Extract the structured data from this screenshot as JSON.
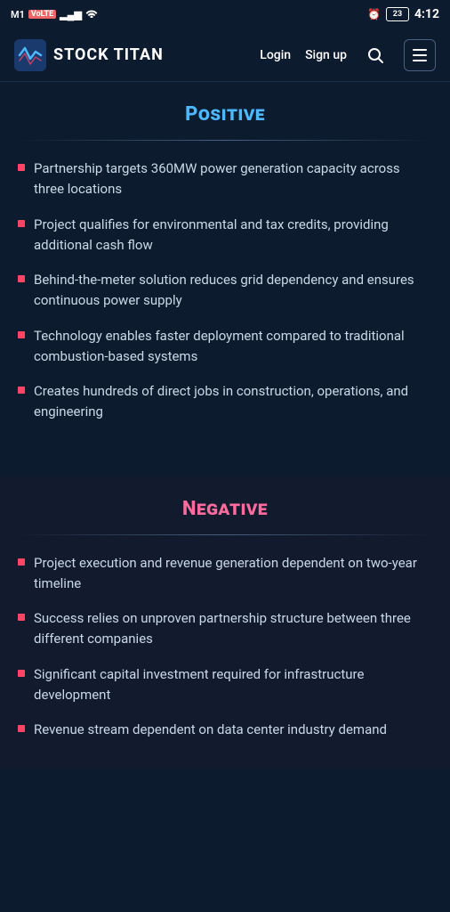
{
  "status_bar": {
    "carrier": "M1",
    "network_type": "VoLTE",
    "signal_bars": "▂▄▆",
    "wifi": "WiFi",
    "alarm": "⏰",
    "battery_level": "23",
    "time": "4:12"
  },
  "navbar": {
    "logo_text": "STOCK TITAN",
    "login_label": "Login",
    "signup_label": "Sign up"
  },
  "positive_section": {
    "title": "Positive",
    "items": [
      "Partnership targets 360MW power generation capacity across three locations",
      "Project qualifies for environmental and tax credits, providing additional cash flow",
      "Behind-the-meter solution reduces grid dependency and ensures continuous power supply",
      "Technology enables faster deployment compared to traditional combustion-based systems",
      "Creates hundreds of direct jobs in construction, operations, and engineering"
    ]
  },
  "negative_section": {
    "title": "Negative",
    "items": [
      "Project execution and revenue generation dependent on two-year timeline",
      "Success relies on unproven partnership structure between three different companies",
      "Significant capital investment required for infrastructure development",
      "Revenue stream dependent on data center industry demand"
    ]
  }
}
